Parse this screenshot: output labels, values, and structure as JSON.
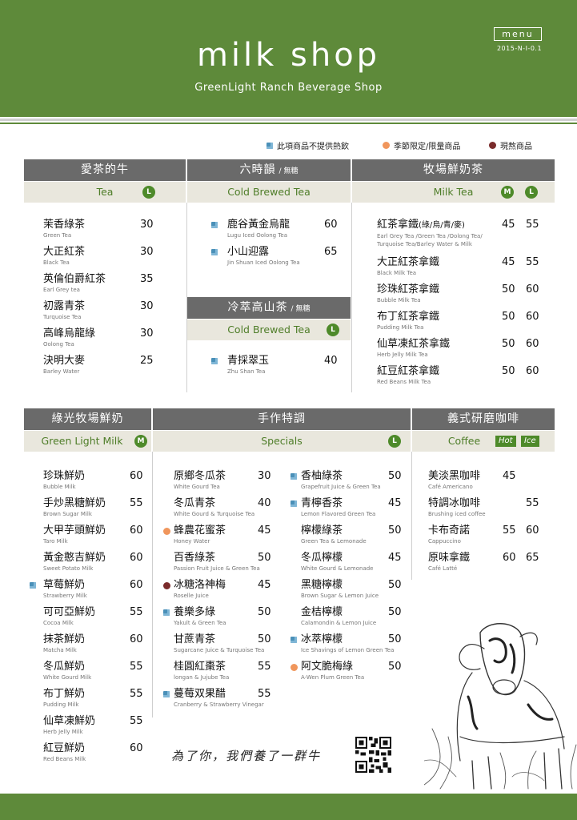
{
  "header": {
    "title": "milk shop",
    "subtitle": "GreenLight Ranch Beverage Shop",
    "menu_label": "menu",
    "date": "2015-N-I-0.1"
  },
  "legend": {
    "no_hot": "此項商品不提供熱飲",
    "seasonal": "季節限定/限量商品",
    "fresh_made": "現熬商品"
  },
  "colors": {
    "brand_green": "#5e8a3a",
    "section_gray": "#6a6a6a",
    "band_beige": "#e9e7dd",
    "icon_blue": "#4a90b8",
    "seasonal_orange": "#f0965c",
    "fresh_red": "#7a2b2b"
  },
  "tea": {
    "title": "愛茶的牛",
    "en": "Tea",
    "size": "L",
    "items": [
      {
        "zh": "茉香綠茶",
        "en": "Green Tea",
        "price": "30"
      },
      {
        "zh": "大正紅茶",
        "en": "Black Tea",
        "price": "30"
      },
      {
        "zh": "英倫伯爵紅茶",
        "en": "Earl Grey tea",
        "price": "35"
      },
      {
        "zh": "初露青茶",
        "en": "Turquoise Tea",
        "price": "30"
      },
      {
        "zh": "高峰烏龍綠",
        "en": "Oolong Tea",
        "price": "30"
      },
      {
        "zh": "決明大麥",
        "en": "Barley Water",
        "price": "25"
      }
    ]
  },
  "cold_brew": {
    "title": "六時韻",
    "note": "/ 無糖",
    "en": "Cold Brewed Tea",
    "items": [
      {
        "zh": "鹿谷黃金烏龍",
        "en": "Lugu Iced Oolong Tea",
        "price": "60"
      },
      {
        "zh": "小山迎露",
        "en": "Jin Shuan Iced Oolong Tea",
        "price": "65"
      }
    ]
  },
  "mountain": {
    "title": "冷萃高山茶",
    "note": "/ 無糖",
    "en": "Cold Brewed Tea",
    "size": "L",
    "items": [
      {
        "zh": "青採翠玉",
        "en": "Zhu Shan Tea",
        "price": "40"
      }
    ]
  },
  "ranch_milk_tea": {
    "title": "牧場鮮奶茶",
    "en": "Milk Tea",
    "size_m": "M",
    "size_l": "L",
    "items": [
      {
        "zh": "紅茶拿鐵",
        "tag": "(綠/烏/青/麥)",
        "en": "Earl Grey Tea /Green Tea /Oolong Tea/",
        "en2": "Turquoise Tea/Barley Water & Milk",
        "m": "45",
        "l": "55"
      },
      {
        "zh": "大正紅茶拿鐵",
        "en": "Black Milk Tea",
        "m": "45",
        "l": "55"
      },
      {
        "zh": "珍珠紅茶拿鐵",
        "en": "Bubble Milk Tea",
        "m": "50",
        "l": "60"
      },
      {
        "zh": "布丁紅茶拿鐵",
        "en": "Pudding Milk Tea",
        "m": "50",
        "l": "60"
      },
      {
        "zh": "仙草凍紅茶拿鐵",
        "en": "Herb Jelly Milk Tea",
        "m": "50",
        "l": "60"
      },
      {
        "zh": "紅豆紅茶拿鐵",
        "en": "Red Beans Milk Tea",
        "m": "50",
        "l": "60"
      }
    ]
  },
  "green_milk": {
    "title": "綠光牧場鮮奶",
    "en": "Green Light Milk",
    "size": "M",
    "items": [
      {
        "zh": "珍珠鮮奶",
        "en": "Bubble Milk",
        "price": "60"
      },
      {
        "zh": "手炒黑糖鮮奶",
        "en": "Brown Sugar Milk",
        "price": "55"
      },
      {
        "zh": "大甲芋頭鮮奶",
        "en": "Taro Milk",
        "price": "60"
      },
      {
        "zh": "黃金憨吉鮮奶",
        "en": "Sweet Potato Milk",
        "price": "60"
      },
      {
        "zh": "草莓鮮奶",
        "en": "Strawberry Milk",
        "price": "60"
      },
      {
        "zh": "可可亞鮮奶",
        "en": "Cocoa Milk",
        "price": "55"
      },
      {
        "zh": "抹茶鮮奶",
        "en": "Matcha Milk",
        "price": "60"
      },
      {
        "zh": "冬瓜鮮奶",
        "en": "White Gourd Milk",
        "price": "55"
      },
      {
        "zh": "布丁鮮奶",
        "en": "Pudding Milk",
        "price": "55"
      },
      {
        "zh": "仙草凍鮮奶",
        "en": "Herb Jelly Milk",
        "price": "55"
      },
      {
        "zh": "紅豆鮮奶",
        "en": "Red Beans Milk",
        "price": "60"
      }
    ]
  },
  "specials": {
    "title": "手作特調",
    "en": "Specials",
    "size": "L",
    "col1": [
      {
        "zh": "原鄉冬瓜茶",
        "en": "White Gourd Tea",
        "price": "30"
      },
      {
        "zh": "冬瓜青茶",
        "en": "White Gourd & Turquoise Tea",
        "price": "40"
      },
      {
        "zh": "蜂農花蜜茶",
        "en": "Honey Water",
        "price": "45"
      },
      {
        "zh": "百香綠茶",
        "en": "Passion Fruit Juice & Green Tea",
        "price": "50"
      },
      {
        "zh": "冰糖洛神梅",
        "en": "Roselle Juice",
        "price": "45"
      },
      {
        "zh": "養樂多綠",
        "en": "Yakult & Green Tea",
        "price": "50"
      },
      {
        "zh": "甘蔗青茶",
        "en": "Sugarcane Juice & Turquoise Tea",
        "price": "50"
      },
      {
        "zh": "桂圓紅棗茶",
        "en": "longan & Jujube Tea",
        "price": "55"
      },
      {
        "zh": "蔓莓双果醋",
        "en": "Cranberry & Strawberry Vinegar",
        "price": "55"
      }
    ],
    "col2": [
      {
        "zh": "香柚綠茶",
        "en": "Grapefruit Juice & Green Tea",
        "price": "50"
      },
      {
        "zh": "青檸香茶",
        "en": "Lemon Flavored Green Tea",
        "price": "45"
      },
      {
        "zh": "檸檬綠茶",
        "en": "Green Tea & Lemonade",
        "price": "50"
      },
      {
        "zh": "冬瓜檸檬",
        "en": "White Gourd & Lemonade",
        "price": "45"
      },
      {
        "zh": "黑糖檸檬",
        "en": "Brown Sugar & Lemon Juice",
        "price": "50"
      },
      {
        "zh": "金桔檸檬",
        "en": "Calamondin & Lemon Juice",
        "price": "50"
      },
      {
        "zh": "冰萃檸檬",
        "en": "Ice Shavings of Lemon Green Tea",
        "price": "50"
      },
      {
        "zh": "阿文脆梅綠",
        "en": "A-Wen Plum Green Tea",
        "price": "50"
      }
    ]
  },
  "coffee": {
    "title": "義式研磨咖啡",
    "en": "Coffee",
    "hot": "Hot",
    "ice": "Ice",
    "items": [
      {
        "zh": "美淡黑咖啡",
        "en": "Café Americano",
        "hot": "45",
        "ice": ""
      },
      {
        "zh": "特調冰咖啡",
        "en": "Brushing iced coffee",
        "hot": "",
        "ice": "55"
      },
      {
        "zh": "卡布奇諾",
        "en": "Cappuccino",
        "hot": "55",
        "ice": "60"
      },
      {
        "zh": "原味拿鐵",
        "en": "Café Latté",
        "hot": "60",
        "ice": "65"
      }
    ]
  },
  "footer": {
    "slogan": "為了你，我們養了一群牛"
  }
}
